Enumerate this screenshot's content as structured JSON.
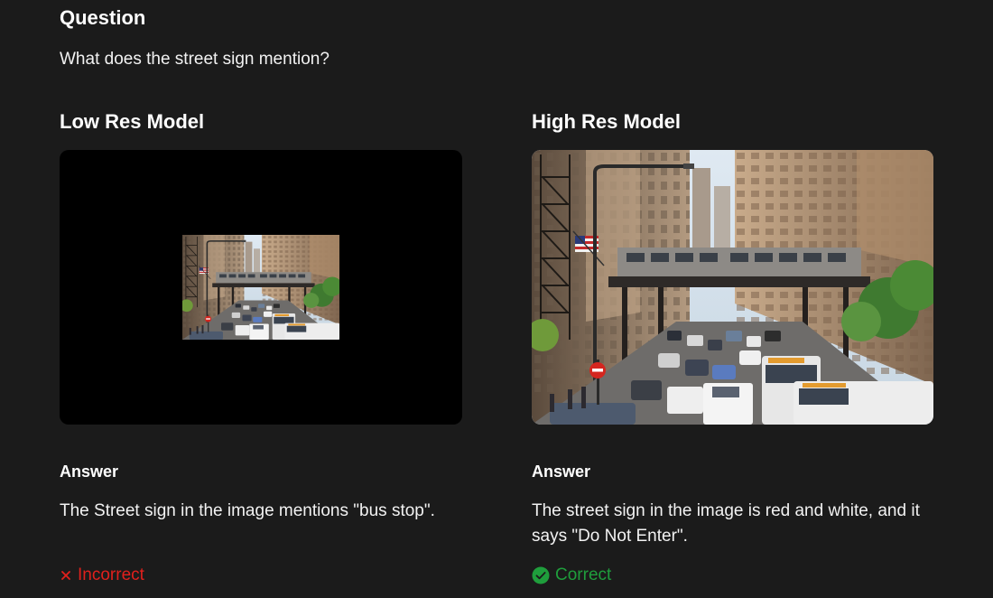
{
  "question": {
    "heading": "Question",
    "text": "What does the street sign mention?"
  },
  "models": {
    "low": {
      "title": "Low Res Model",
      "answer_heading": "Answer",
      "answer_text": "The Street sign in the image mentions \"bus stop\".",
      "verdict": "Incorrect",
      "verdict_icon": "x-icon",
      "verdict_color": "#e0201c"
    },
    "high": {
      "title": "High Res Model",
      "answer_heading": "Answer",
      "answer_text": "The street sign in the image is red and white, and it says \"Do Not Enter\".",
      "verdict": "Correct",
      "verdict_icon": "check-circle-icon",
      "verdict_color": "#1f9e3c"
    }
  },
  "colors": {
    "background": "#1b1b1b",
    "text": "#ffffff",
    "incorrect": "#e0201c",
    "correct": "#1f9e3c"
  }
}
